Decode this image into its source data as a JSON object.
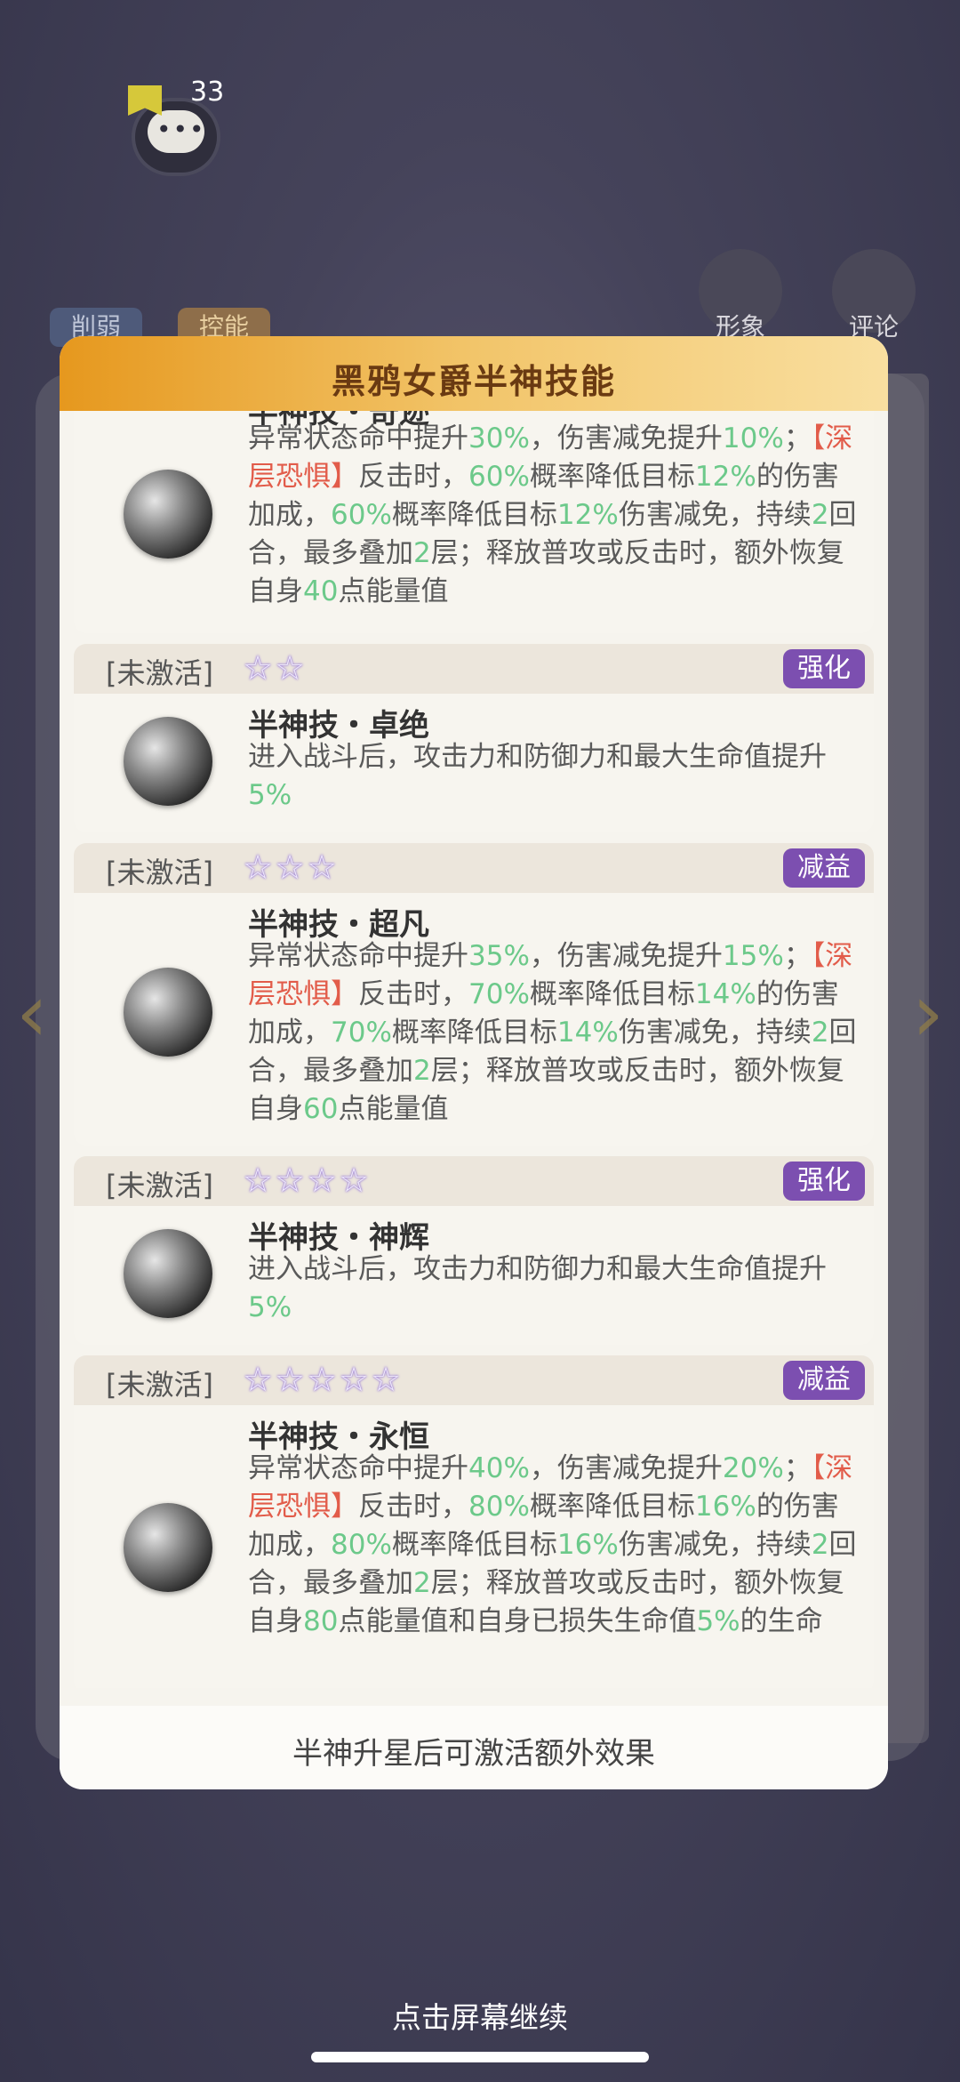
{
  "background": {
    "message_count": "33",
    "tags": [
      "削弱",
      "控能"
    ],
    "side_buttons": [
      "形象",
      "评论"
    ]
  },
  "dialog": {
    "title": "黑鸦女爵半神技能",
    "footer": "半神升星后可激活额外效果",
    "skills": [
      {
        "name_partial": "半神技・奇迹",
        "desc_parts": [
          "异常状态命中提升",
          "30%",
          "，伤害减免提升",
          "10%",
          "；",
          "【深层恐惧】",
          "反击时，",
          "60%",
          "概率降低目标",
          "12%",
          "的伤害加成，",
          "60%",
          "概率降低目标",
          "12%",
          "伤害减免，持续",
          "2",
          "回合，最多叠加",
          "2",
          "层；释放普攻或反击时，额外恢复自身",
          "40",
          "点能量值"
        ]
      },
      {
        "status": "[未激活]",
        "stars": 2,
        "badge": "强化",
        "name": "半神技・卓绝",
        "desc_parts": [
          "进入战斗后，攻击力和防御力和最大生命值提升",
          "5%"
        ]
      },
      {
        "status": "[未激活]",
        "stars": 3,
        "badge": "减益",
        "name": "半神技・超凡",
        "desc_parts": [
          "异常状态命中提升",
          "35%",
          "，伤害减免提升",
          "15%",
          "；",
          "【深层恐惧】",
          "反击时，",
          "70%",
          "概率降低目标",
          "14%",
          "的伤害加成，",
          "70%",
          "概率降低目标",
          "14%",
          "伤害减免，持续",
          "2",
          "回合，最多叠加",
          "2",
          "层；释放普攻或反击时，额外恢复自身",
          "60",
          "点能量值"
        ]
      },
      {
        "status": "[未激活]",
        "stars": 4,
        "badge": "强化",
        "name": "半神技・神辉",
        "desc_parts": [
          "进入战斗后，攻击力和防御力和最大生命值提升",
          "5%"
        ]
      },
      {
        "status": "[未激活]",
        "stars": 5,
        "badge": "减益",
        "name": "半神技・永恒",
        "desc_parts": [
          "异常状态命中提升",
          "40%",
          "，伤害减免提升",
          "20%",
          "；",
          "【深层恐惧】",
          "反击时，",
          "80%",
          "概率降低目标",
          "16%",
          "的伤害加成，",
          "80%",
          "概率降低目标",
          "16%",
          "伤害减免，持续",
          "2",
          "回合，最多叠加",
          "2",
          "层；释放普攻或反击时，额外恢复自身",
          "80",
          "点能量值和自身已损失生命值",
          "5%",
          "的生命"
        ]
      }
    ]
  },
  "continue_hint": "点击屏幕继续",
  "colors": {
    "highlight_green": "#6cc98a",
    "highlight_red": "#e25c4a",
    "badge_purple": "#7c4fb0",
    "header_orange": "#e6981e"
  }
}
